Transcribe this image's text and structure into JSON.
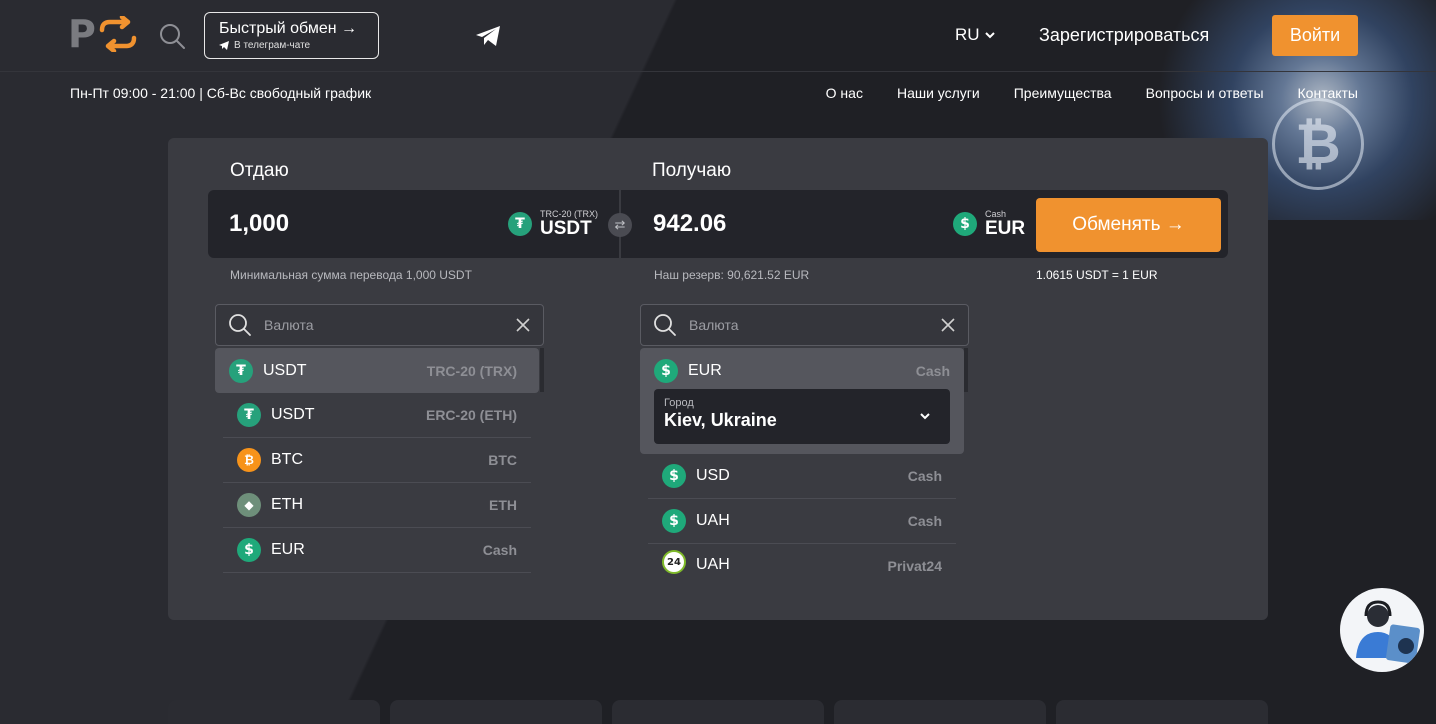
{
  "header": {
    "quick_exchange": {
      "title": "Быстрый обмен →",
      "subtitle": "В телеграм-чате"
    },
    "lang": "RU",
    "register": "Зарегистрироваться",
    "login": "Войти"
  },
  "subbar": {
    "hours": "Пн-Пт 09:00 - 21:00 | Сб-Вс свободный график",
    "nav": [
      "О нас",
      "Наши услуги",
      "Преимущества",
      "Вопросы и ответы",
      "Контакты"
    ]
  },
  "exchange": {
    "give_label": "Отдаю",
    "get_label": "Получаю",
    "give_amount": "1,000",
    "give_network": "TRC-20 (TRX)",
    "give_code": "USDT",
    "get_amount": "942.06",
    "get_network": "Cash",
    "get_code": "EUR",
    "exchange_button": "Обменять →",
    "min_note": "Минимальная сумма перевода 1,000 USDT",
    "reserve_note": "Наш резерв: 90,621.52 EUR",
    "rate": "1.0615 USDT = 1 EUR"
  },
  "search": {
    "placeholder": "Валюта"
  },
  "give_list": [
    {
      "name": "USDT",
      "tag": "TRC-20 (TRX)",
      "icon": "tether-icon"
    },
    {
      "name": "USDT",
      "tag": "ERC-20 (ETH)",
      "icon": "tether-icon"
    },
    {
      "name": "BTC",
      "tag": "BTC",
      "icon": "bitcoin-icon"
    },
    {
      "name": "ETH",
      "tag": "ETH",
      "icon": "ethereum-icon"
    },
    {
      "name": "EUR",
      "tag": "Cash",
      "icon": "dollar-icon"
    }
  ],
  "get_list": [
    {
      "name": "EUR",
      "tag": "Cash",
      "icon": "dollar-icon"
    },
    {
      "name": "USD",
      "tag": "Cash",
      "icon": "dollar-icon"
    },
    {
      "name": "UAH",
      "tag": "Cash",
      "icon": "dollar-icon"
    },
    {
      "name": "UAH",
      "tag": "Privat24",
      "icon": "privat24-icon"
    }
  ],
  "city": {
    "label": "Город",
    "value": "Kiev, Ukraine"
  },
  "colors": {
    "accent": "#f0922f",
    "background": "#24252a",
    "panel": "#3a3b41",
    "input": "#23242a",
    "tether": "#26a17b"
  }
}
